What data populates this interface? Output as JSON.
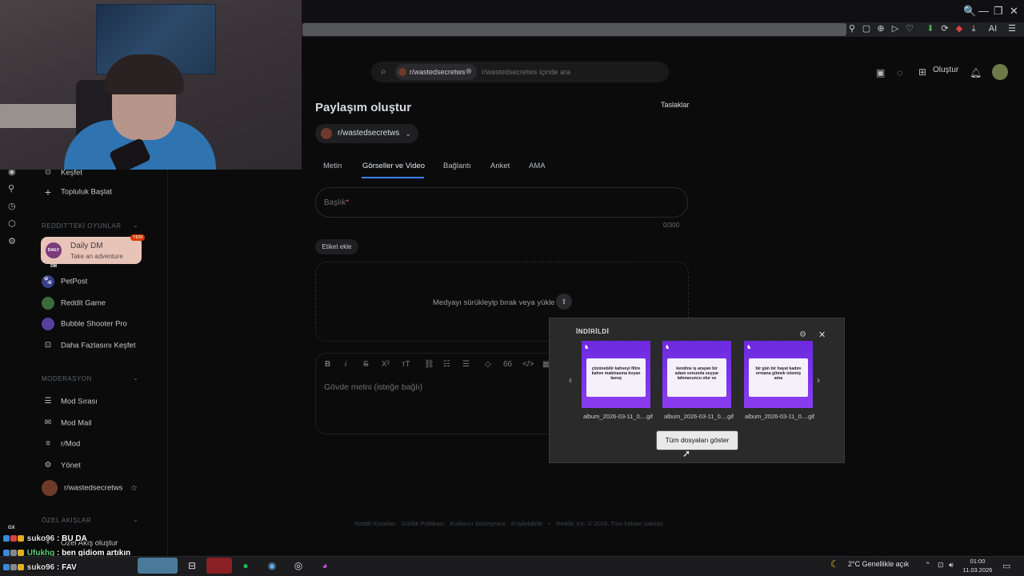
{
  "browser": {
    "window_controls": [
      "🔍",
      "—",
      "❐",
      "✕"
    ],
    "toolbar_icons": [
      "⚲",
      "▢",
      "⊕",
      "▷",
      "♡",
      "⬇",
      "⟳",
      "◆",
      "⤓"
    ],
    "ai_label": "AI"
  },
  "header": {
    "search_chip": "r/wastedsecretws",
    "search_placeholder": "r/wastedsecretws içinde ara",
    "create_label": "Oluştur"
  },
  "sidebar": {
    "items_top": [
      {
        "label": "Keşfet",
        "icon": "compass-icon"
      },
      {
        "label": "Topluluk Başlat",
        "icon": "plus-icon"
      }
    ],
    "games_heading": "REDDIT'TEKİ OYUNLAR",
    "daily_dm": {
      "title": "Daily DM",
      "subtitle": "Take an adventure",
      "logo": "DAILY DM",
      "badge": "YENİ"
    },
    "games": [
      {
        "label": "PetPost",
        "color": "#3a3f8a"
      },
      {
        "label": "Reddit Game",
        "color": "#3c6a3c"
      },
      {
        "label": "Bubble Shooter Pro",
        "color": "#5a3fa0"
      },
      {
        "label": "Daha Fazlasını Keşfet",
        "color": "transparent"
      }
    ],
    "mod_heading": "MODERASYON",
    "mod_items": [
      {
        "label": "Mod Sırası"
      },
      {
        "label": "Mod Mail"
      },
      {
        "label": "r/Mod"
      },
      {
        "label": "Yönet"
      },
      {
        "label": "r/wastedsecretws"
      }
    ],
    "custom_heading": "ÖZEL AKIŞLAR",
    "custom_item": "Özel Akış oluştur"
  },
  "post_form": {
    "title": "Paylaşım oluştur",
    "drafts": "Taslaklar",
    "community": "r/wastedsecretws",
    "tabs": [
      "Metin",
      "Görseller ve Video",
      "Bağlantı",
      "Anket",
      "AMA"
    ],
    "active_tab": "Görseller ve Video",
    "title_placeholder": "Başlık",
    "required_mark": "*",
    "counter": "0/300",
    "tag_button": "Etiket ekle",
    "dropzone_text": "Medyayı sürükleyip bırak veya yükle",
    "body_placeholder": "Gövde metni (isteğe bağlı)"
  },
  "footer": {
    "links": [
      "Reddit Kuralları",
      "Gizlilik Politikası",
      "Kullanıcı Sözleşmesi",
      "Erişilebilirlik",
      "•",
      "Reddit, Inc. © 2026. Tüm hakları saklıdır."
    ]
  },
  "download_popup": {
    "title": "İNDİRİLDİ",
    "files": [
      {
        "name": "album_2026-03-11_0....gif",
        "caption": "çözünebilir kahveyi filtre kahve makinasına koyan lavuq"
      },
      {
        "name": "album_2026-03-11_0....gif",
        "caption": "kendine iş arayan bir adam sonunda seyyar lahmacuncu olur ve"
      },
      {
        "name": "album_2026-03-11_0....gif",
        "caption": "bir gün bir hayat kadını ormana gitmek istemiş ama"
      }
    ],
    "show_all": "Tüm dosyaları göster"
  },
  "chat": {
    "platform_tag": "GX",
    "messages": [
      {
        "user": "suko96",
        "text": "BU DA"
      },
      {
        "user": "Ufukhg",
        "text": "ben gidiom artıkın"
      },
      {
        "user": "suko96",
        "text": "FAV"
      }
    ]
  },
  "taskbar": {
    "weather": "2°C  Genellikle açık",
    "time": "01:00",
    "date": "11.03.2026"
  }
}
